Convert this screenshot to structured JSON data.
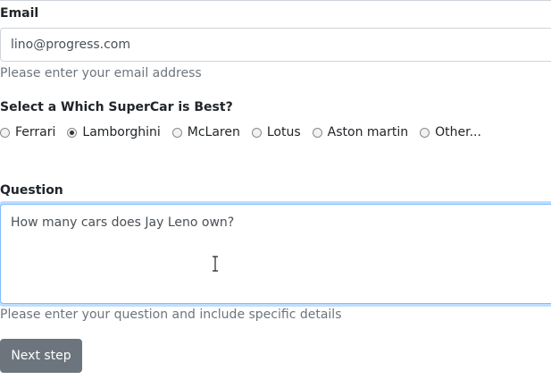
{
  "email": {
    "label": "Email",
    "value": "lino@progress.com",
    "help": "Please enter your email address"
  },
  "supercar": {
    "label": "Select a Which SuperCar is Best?",
    "selected": "Lamborghini",
    "options": [
      {
        "label": "Ferrari",
        "checked": false
      },
      {
        "label": "Lamborghini",
        "checked": true
      },
      {
        "label": "McLaren",
        "checked": false
      },
      {
        "label": "Lotus",
        "checked": false
      },
      {
        "label": "Aston martin",
        "checked": false
      },
      {
        "label": "Other...",
        "checked": false
      }
    ]
  },
  "question": {
    "label": "Question",
    "value": "How many cars does Jay Leno own?",
    "help": "Please enter your question and include specific details"
  },
  "actions": {
    "next_label": "Next step"
  }
}
